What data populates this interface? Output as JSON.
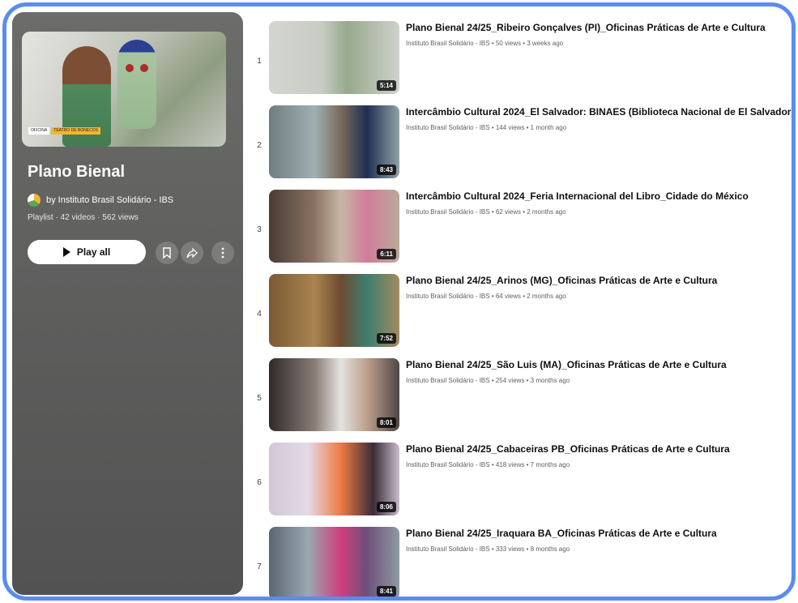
{
  "playlist": {
    "title": "Plano Bienal",
    "owner": "by Instituto Brasil Solidário - IBS",
    "stats": "Playlist · 42 videos · 562 views",
    "play_all_label": "Play all",
    "hero_tags": [
      "OFICINA",
      "TEATRO DE BONECOS"
    ]
  },
  "videos": [
    {
      "index": "1",
      "title": "Plano Bienal 24/25_Ribeiro Gonçalves (PI)_Oficinas Práticas de Arte e Cultura",
      "meta": "Instituto Brasil Solidário - IBS • 50 views • 3 weeks ago",
      "duration": "5:14"
    },
    {
      "index": "2",
      "title": "Intercâmbio Cultural 2024_El Salvador: BINAES (Biblioteca Nacional de El Salvador)",
      "meta": "Instituto Brasil Solidário - IBS • 144 views • 1 month ago",
      "duration": "8:43"
    },
    {
      "index": "3",
      "title": "Intercâmbio Cultural 2024_Feria Internacional del Libro_Cidade do México",
      "meta": "Instituto Brasil Solidário - IBS • 62 views • 2 months ago",
      "duration": "6:11"
    },
    {
      "index": "4",
      "title": "Plano Bienal 24/25_Arinos (MG)_Oficinas Práticas de Arte e Cultura",
      "meta": "Instituto Brasil Solidário - IBS • 64 views • 2 months ago",
      "duration": "7:52"
    },
    {
      "index": "5",
      "title": "Plano Bienal 24/25_São Luis (MA)_Oficinas Práticas de Arte e Cultura",
      "meta": "Instituto Brasil Solidário - IBS • 254 views • 3 months ago",
      "duration": "8:01"
    },
    {
      "index": "6",
      "title": "Plano Bienal 24/25_Cabaceiras PB_Oficinas Práticas de Arte e Cultura",
      "meta": "Instituto Brasil Solidário - IBS • 418 views • 7 months ago",
      "duration": "8:06"
    },
    {
      "index": "7",
      "title": "Plano Bienal 24/25_Iraquara BA_Oficinas Práticas de Arte e Cultura",
      "meta": "Instituto Brasil Solidário - IBS • 333 views • 8 months ago",
      "duration": "8:41"
    }
  ],
  "colors": {
    "frame_border": "#5b8cf0",
    "progress": "#ff0033",
    "hero_tag": "#f2b632"
  }
}
